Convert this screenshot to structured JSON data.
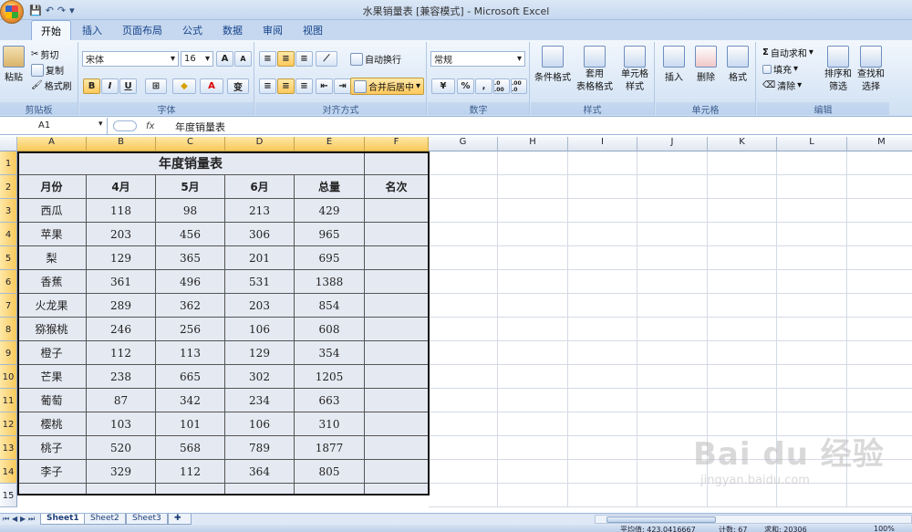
{
  "window": {
    "title": "水果销量表  [兼容模式] - Microsoft Excel"
  },
  "tabs": [
    "开始",
    "插入",
    "页面布局",
    "公式",
    "数据",
    "审阅",
    "视图"
  ],
  "ribbon": {
    "clipboard": {
      "paste": "粘贴",
      "cut": "剪切",
      "copy": "复制",
      "format_painter": "格式刷",
      "label": "剪贴板"
    },
    "font": {
      "name": "宋体",
      "size": "16",
      "bold": "B",
      "italic": "I",
      "underline": "U",
      "grow": "A",
      "shrink": "A",
      "phonetic": "变",
      "label": "字体"
    },
    "alignment": {
      "wrap": "自动换行",
      "merge": "合并后居中",
      "label": "对齐方式"
    },
    "number": {
      "format": "常规",
      "percent": "%",
      "comma": ",",
      "inc": ".0 .00",
      "dec": ".00 .0",
      "label": "数字"
    },
    "styles": {
      "conditional": "条件格式",
      "table_format_1": "套用",
      "table_format_2": "表格格式",
      "cell_styles_1": "单元格",
      "cell_styles_2": "样式",
      "label": "样式"
    },
    "cells": {
      "insert": "插入",
      "delete": "删除",
      "format": "格式",
      "label": "单元格"
    },
    "editing": {
      "autosum": "自动求和",
      "fill": "填充",
      "clear": "清除",
      "sort_1": "排序和",
      "sort_2": "筛选",
      "find_1": "查找和",
      "find_2": "选择",
      "label": "编辑"
    }
  },
  "formula_bar": {
    "name_box": "A1",
    "fx": "fx",
    "content": "年度销量表"
  },
  "columns": [
    "A",
    "B",
    "C",
    "D",
    "E",
    "F",
    "G",
    "H",
    "I",
    "J",
    "K",
    "L",
    "M"
  ],
  "rows": [
    "1",
    "2",
    "3",
    "4",
    "5",
    "6",
    "7",
    "8",
    "9",
    "10",
    "11",
    "12",
    "13",
    "14",
    "15"
  ],
  "table": {
    "title": "年度销量表",
    "headers": [
      "月份",
      "4月",
      "5月",
      "6月",
      "总量",
      "名次"
    ],
    "rows": [
      [
        "西瓜",
        "118",
        "98",
        "213",
        "429",
        ""
      ],
      [
        "苹果",
        "203",
        "456",
        "306",
        "965",
        ""
      ],
      [
        "梨",
        "129",
        "365",
        "201",
        "695",
        ""
      ],
      [
        "香蕉",
        "361",
        "496",
        "531",
        "1388",
        ""
      ],
      [
        "火龙果",
        "289",
        "362",
        "203",
        "854",
        ""
      ],
      [
        "猕猴桃",
        "246",
        "256",
        "106",
        "608",
        ""
      ],
      [
        "橙子",
        "112",
        "113",
        "129",
        "354",
        ""
      ],
      [
        "芒果",
        "238",
        "665",
        "302",
        "1205",
        ""
      ],
      [
        "葡萄",
        "87",
        "342",
        "234",
        "663",
        ""
      ],
      [
        "樱桃",
        "103",
        "101",
        "106",
        "310",
        ""
      ],
      [
        "桃子",
        "520",
        "568",
        "789",
        "1877",
        ""
      ],
      [
        "李子",
        "329",
        "112",
        "364",
        "805",
        ""
      ]
    ]
  },
  "sheets": [
    "Sheet1",
    "Sheet2",
    "Sheet3"
  ],
  "status": {
    "average": "平均值: 423.0416667",
    "count": "计数: 67",
    "sum": "求和: 20306",
    "zoom": "100%"
  },
  "watermark": {
    "brand": "Bai du 经验",
    "url": "jingyan.baidu.com"
  }
}
